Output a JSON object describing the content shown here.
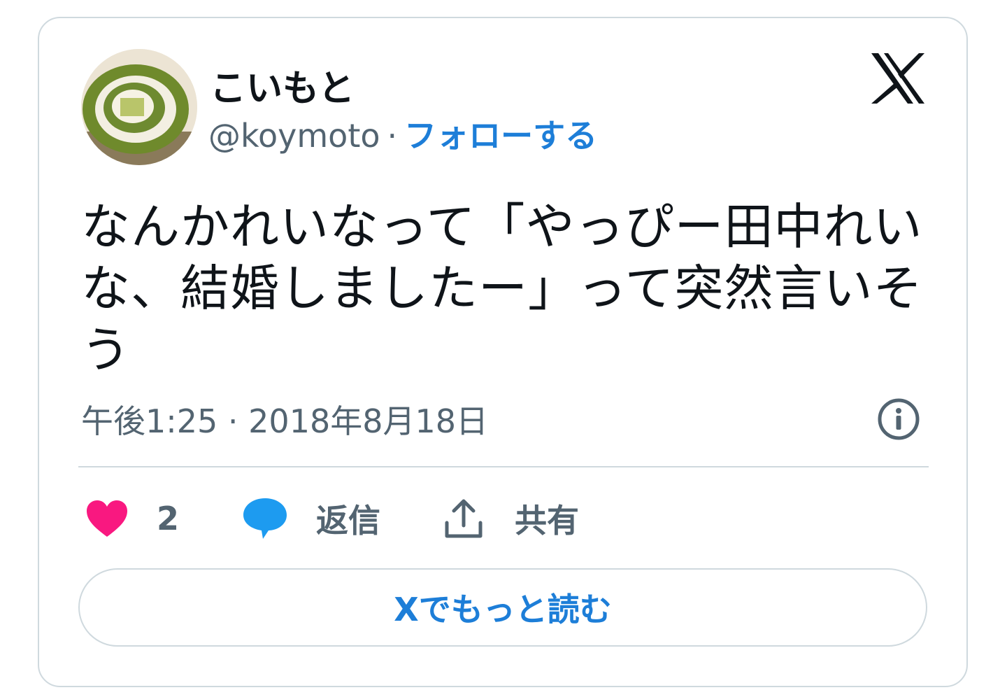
{
  "author": {
    "display_name": "こいもと",
    "handle": "@koymoto",
    "separator": "·",
    "follow_label": "フォローする"
  },
  "tweet": {
    "text": "なんかれいなって「やっぴー田中れいな、結婚しましたー」って突然言いそう",
    "timestamp": "午後1:25 · 2018年8月18日"
  },
  "actions": {
    "like_count": "2",
    "reply_label": "返信",
    "share_label": "共有"
  },
  "read_more_label": "Xでもっと読む",
  "colors": {
    "accent": "#1d7ed8",
    "like": "#f91880",
    "reply": "#1d9bf0",
    "muted": "#536471",
    "border": "#cfd9de"
  },
  "icons": [
    "x-logo-icon",
    "info-icon",
    "heart-icon",
    "reply-bubble-icon",
    "share-icon"
  ]
}
